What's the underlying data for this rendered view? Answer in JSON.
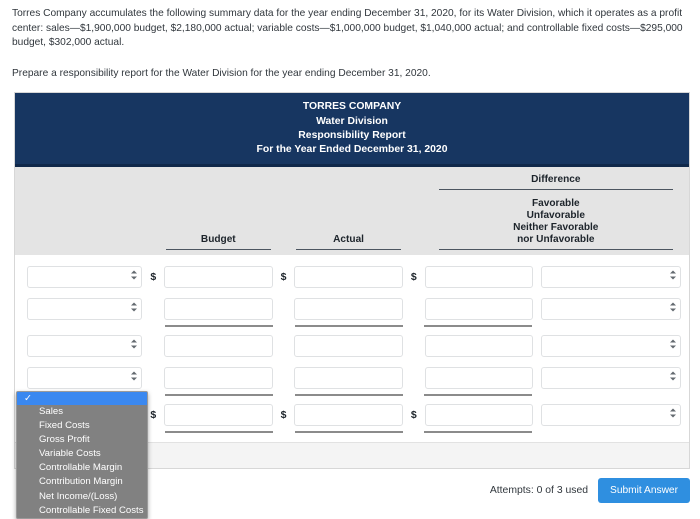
{
  "problem": {
    "paragraph1": "Torres Company accumulates the following summary data for the year ending December 31, 2020, for its Water Division, which it operates as a profit center: sales—$1,900,000 budget, $2,180,000 actual; variable costs—$1,000,000 budget, $1,040,000 actual; and controllable fixed costs—$295,000 budget, $302,000 actual.",
    "paragraph2": "Prepare a responsibility report for the Water Division for the year ending December 31, 2020."
  },
  "report": {
    "title_line1": "TORRES COMPANY",
    "title_line2": "Water Division",
    "title_line3": "Responsibility Report",
    "title_line4": "For the Year Ended December 31, 2020",
    "headers": {
      "budget": "Budget",
      "actual": "Actual",
      "difference": "Difference",
      "diff_sub_line1": "Favorable",
      "diff_sub_line2": "Unfavorable",
      "diff_sub_line3": "Neither Favorable",
      "diff_sub_line4": "nor Unfavorable"
    },
    "dollar_sign": "$",
    "rows": [
      {
        "account": "",
        "budget": "",
        "actual": "",
        "difference": "",
        "diff_label": "",
        "show_dollar": true
      },
      {
        "account": "",
        "budget": "",
        "actual": "",
        "difference": "",
        "diff_label": "",
        "show_dollar": false
      },
      {
        "account": "",
        "budget": "",
        "actual": "",
        "difference": "",
        "diff_label": "",
        "show_dollar": false
      },
      {
        "account": "",
        "budget": "",
        "actual": "",
        "difference": "",
        "diff_label": "",
        "show_dollar": false
      },
      {
        "account": "",
        "budget": "",
        "actual": "",
        "difference": "",
        "diff_label": "",
        "show_dollar": true
      }
    ]
  },
  "dropdown": {
    "selected_value": "",
    "checkmark": "✓",
    "options": [
      "Sales",
      "Fixed Costs",
      "Gross Profit",
      "Variable Costs",
      "Controllable Margin",
      "Contribution Margin",
      "Net Income/(Loss)",
      "Controllable Fixed Costs"
    ]
  },
  "footer": {
    "attempts": "Attempts: 0 of 3 used",
    "submit_label": "Submit Answer"
  },
  "colors": {
    "navy": "#173661",
    "header_band": "#e4e4e4",
    "submit_blue": "#2f8fe0",
    "dropdown_highlight": "#3a88f0",
    "dropdown_bg": "#818181"
  }
}
